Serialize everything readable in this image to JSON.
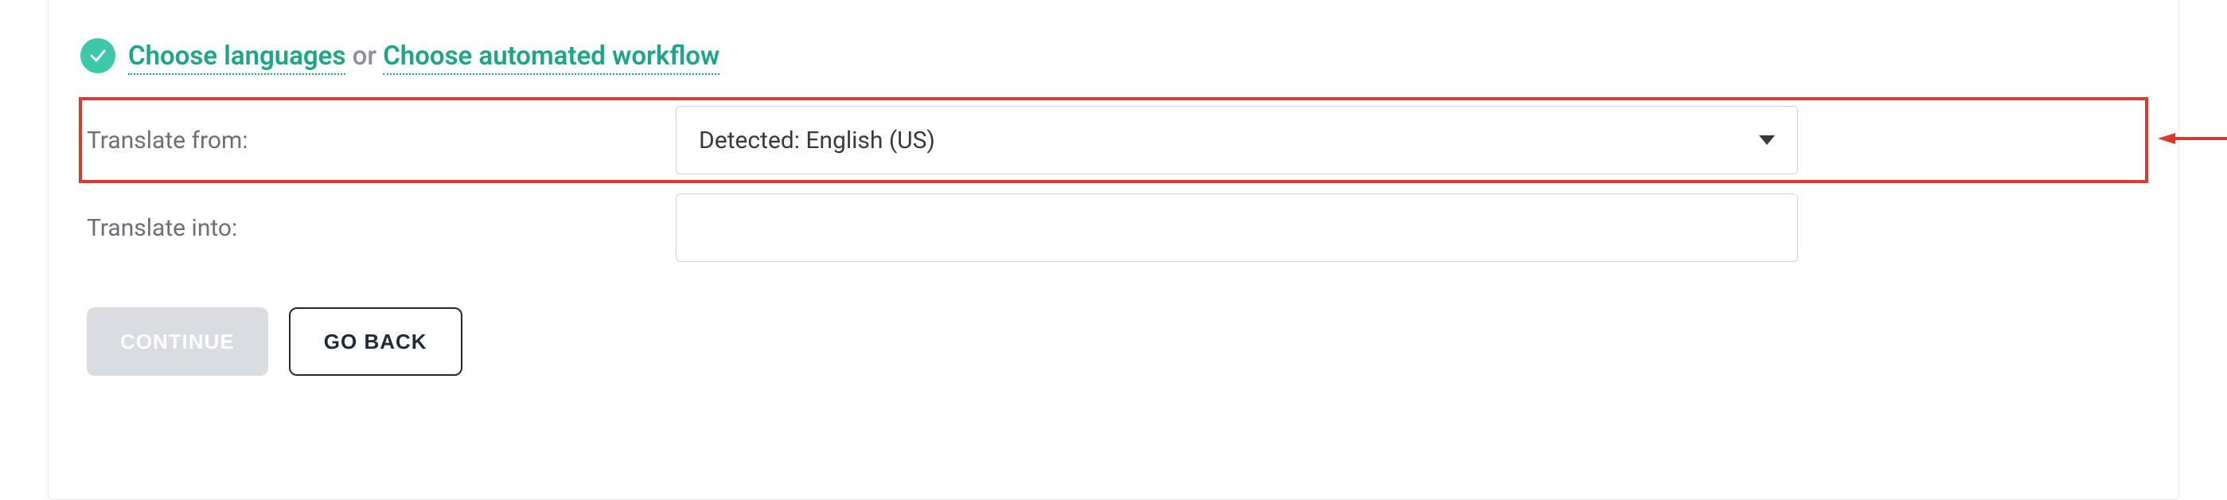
{
  "header": {
    "choose_languages": "Choose languages",
    "or": "or",
    "choose_workflow": "Choose automated workflow"
  },
  "form": {
    "translate_from_label": "Translate from:",
    "translate_from_value": "Detected: English (US)",
    "translate_into_label": "Translate into:",
    "translate_into_value": ""
  },
  "buttons": {
    "continue": "CONTINUE",
    "go_back": "GO BACK"
  }
}
